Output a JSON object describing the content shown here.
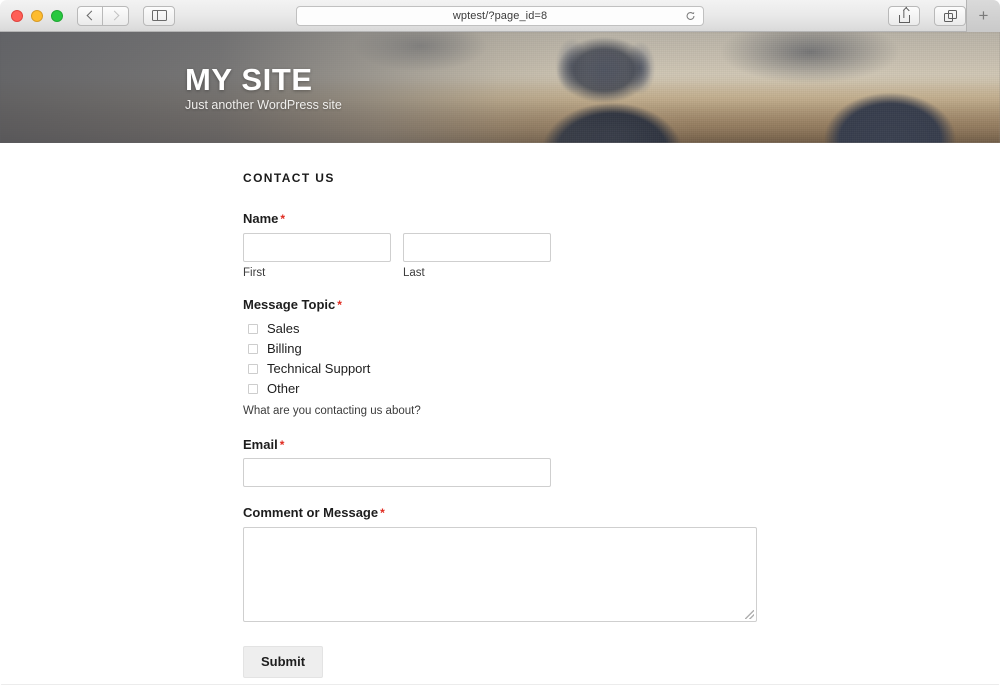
{
  "browser": {
    "url": "wptest/?page_id=8",
    "back_icon": "chevron-left-icon",
    "forward_icon": "chevron-right-icon",
    "sidebar_icon": "sidebar-toggle-icon",
    "reload_icon": "reload-icon",
    "share_icon": "share-icon",
    "tabs_icon": "show-tabs-icon",
    "newtab_label": "+"
  },
  "hero": {
    "title": "MY SITE",
    "tagline": "Just another WordPress site"
  },
  "page": {
    "title": "CONTACT US"
  },
  "form": {
    "name": {
      "label": "Name",
      "required_mark": "*",
      "first": {
        "value": "",
        "sub_label": "First"
      },
      "last": {
        "value": "",
        "sub_label": "Last"
      }
    },
    "message_topic": {
      "label": "Message Topic",
      "required_mark": "*",
      "options": [
        {
          "label": "Sales",
          "checked": false
        },
        {
          "label": "Billing",
          "checked": false
        },
        {
          "label": "Technical Support",
          "checked": false
        },
        {
          "label": "Other",
          "checked": false
        }
      ],
      "help_text": "What are you contacting us about?"
    },
    "email": {
      "label": "Email",
      "required_mark": "*",
      "value": ""
    },
    "comment": {
      "label": "Comment or Message",
      "required_mark": "*",
      "value": ""
    },
    "submit_label": "Submit"
  },
  "colors": {
    "required": "#e02b20",
    "submit_bg": "#eeeeee",
    "input_border": "#cfcfcf"
  }
}
